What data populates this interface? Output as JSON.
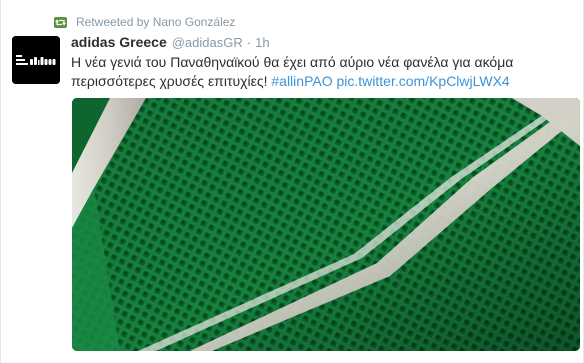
{
  "retweet": {
    "context": "Retweeted by Nano González",
    "icon": "retweet-icon",
    "icon_color": "#5c913b"
  },
  "author": {
    "fullname": "adidas Greece",
    "username": "@adidasGR",
    "separator": "·",
    "time": "1h",
    "avatar_icon": "adidas-logo-icon"
  },
  "tweet": {
    "text": "Η νέα γενιά του Παναθηναϊκού θα έχει από αύριο νέα φανέλα για ακόμα περισσότερες χρυσές επιτυχίες!",
    "hashtag": "#allinPAO",
    "link": "pic.twitter.com/KpClwjLWX4"
  },
  "media": {
    "icon": "green-jersey-fabric-photo",
    "fabric_color": "#17813e",
    "stripe_color": "#d9d6cd"
  },
  "colors": {
    "text": "#292f33",
    "secondary": "#8899a6",
    "link": "#3b94d9"
  }
}
